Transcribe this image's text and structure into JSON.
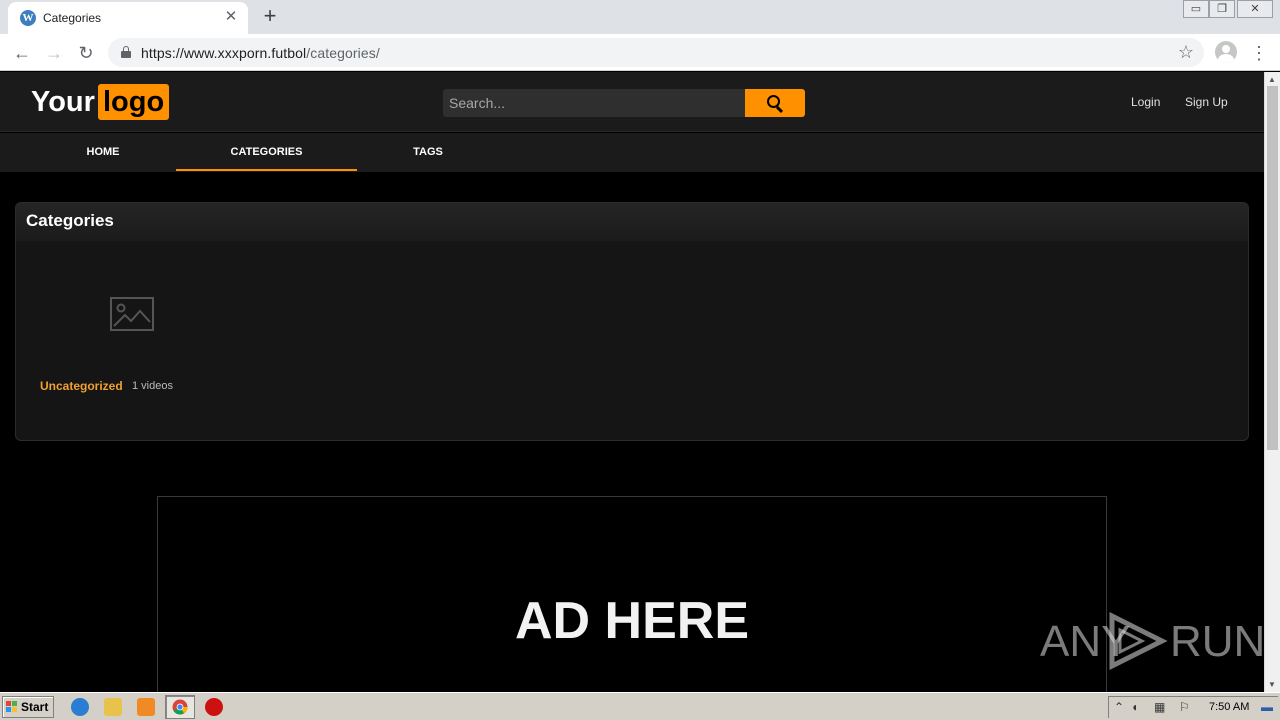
{
  "browser": {
    "tab_title": "Categories",
    "tab_close": "✕",
    "new_tab": "+",
    "url_host": "https://www.xxxporn.futbol",
    "url_path": "/categories/",
    "window_buttons": [
      "▭",
      "❐",
      "✕"
    ]
  },
  "site": {
    "logo_word": "Your",
    "logo_box": "logo",
    "search_placeholder": "Search...",
    "login": "Login",
    "signup": "Sign Up",
    "nav": [
      {
        "label": "HOME",
        "active": false
      },
      {
        "label": "CATEGORIES",
        "active": true
      },
      {
        "label": "TAGS",
        "active": false
      }
    ],
    "panel_title": "Categories",
    "categories": [
      {
        "name": "Uncategorized",
        "count": "1 videos",
        "thumbnail_icon": "image-placeholder-icon"
      }
    ],
    "ad_text": "AD HERE",
    "accent_color": "#ff9000"
  },
  "watermark": {
    "left": "ANY",
    "right": "RUN"
  },
  "taskbar": {
    "start_label": "Start",
    "clock": "7:50 AM",
    "pinned_icons": [
      "internet-explorer-icon",
      "folder-icon",
      "media-player-icon",
      "chrome-icon",
      "opera-icon"
    ]
  }
}
